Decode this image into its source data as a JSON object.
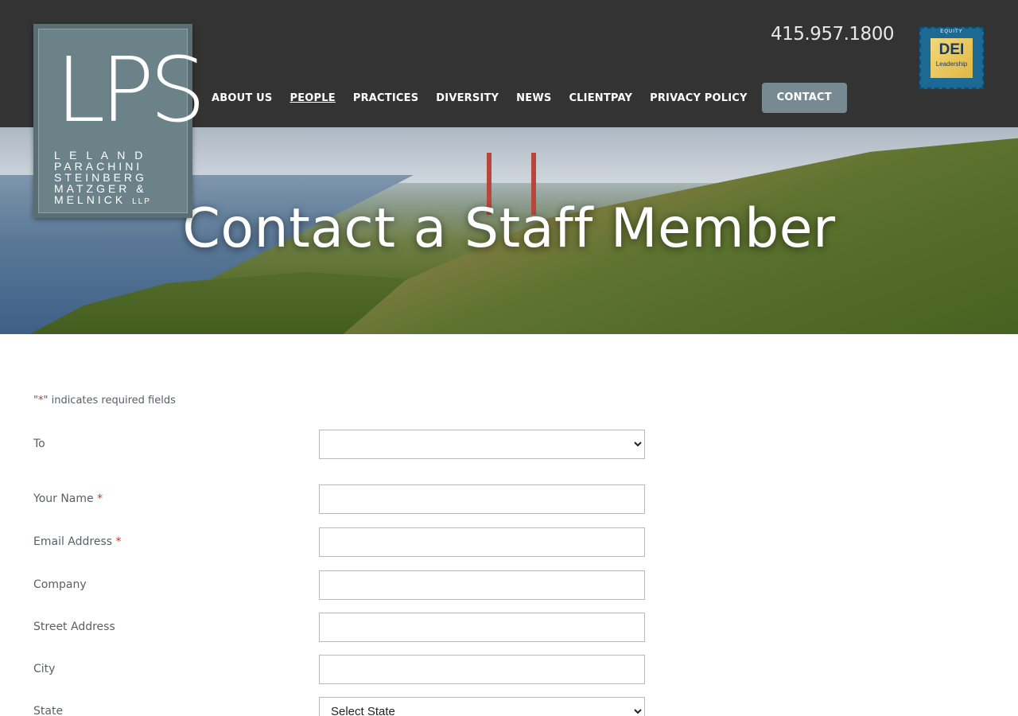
{
  "header": {
    "logo": {
      "mark": "LPS",
      "lines": [
        "L E L A N D",
        "PARACHINI",
        "STEINBERG",
        "MATZGER &",
        "MELNICK"
      ],
      "suffix": "LLP"
    },
    "phone": "415.957.1800",
    "badge": {
      "top": "EQUITY",
      "main": "DEI",
      "sub": "Leadership"
    },
    "nav": [
      {
        "label": "ABOUT US"
      },
      {
        "label": "PEOPLE"
      },
      {
        "label": "PRACTICES"
      },
      {
        "label": "DIVERSITY"
      },
      {
        "label": "NEWS"
      },
      {
        "label": "CLIENTPAY"
      },
      {
        "label": "PRIVACY POLICY"
      },
      {
        "label": "CONTACT"
      }
    ]
  },
  "hero": {
    "title": "Contact a Staff Member"
  },
  "form": {
    "required_note_prefix": "\"",
    "required_note_star": "*",
    "required_note_suffix": "\" indicates required fields",
    "fields": [
      {
        "label": "To",
        "required": false,
        "value": ""
      },
      {
        "label": "Your Name",
        "required": true,
        "value": ""
      },
      {
        "label": "Email Address",
        "required": true,
        "value": ""
      },
      {
        "label": "Company",
        "required": false,
        "value": ""
      },
      {
        "label": "Street Address",
        "required": false,
        "value": ""
      },
      {
        "label": "City",
        "required": false,
        "value": ""
      },
      {
        "label": "State",
        "required": false,
        "value": "Select State"
      }
    ],
    "star": "*"
  },
  "colors": {
    "header_bg": "#333333",
    "contact_button_bg": "#788a91",
    "logo_bg": "#6c8289",
    "required_star": "#c0392b"
  }
}
